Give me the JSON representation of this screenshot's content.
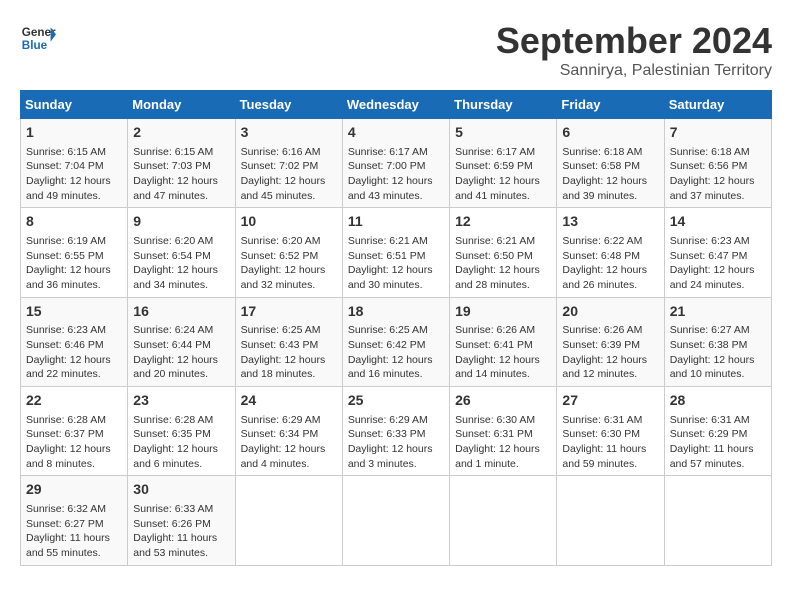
{
  "header": {
    "logo_line1": "General",
    "logo_line2": "Blue",
    "main_title": "September 2024",
    "subtitle": "Sannirya, Palestinian Territory"
  },
  "calendar": {
    "days_of_week": [
      "Sunday",
      "Monday",
      "Tuesday",
      "Wednesday",
      "Thursday",
      "Friday",
      "Saturday"
    ],
    "weeks": [
      [
        {
          "day": "1",
          "sunrise": "Sunrise: 6:15 AM",
          "sunset": "Sunset: 7:04 PM",
          "daylight": "Daylight: 12 hours and 49 minutes."
        },
        {
          "day": "2",
          "sunrise": "Sunrise: 6:15 AM",
          "sunset": "Sunset: 7:03 PM",
          "daylight": "Daylight: 12 hours and 47 minutes."
        },
        {
          "day": "3",
          "sunrise": "Sunrise: 6:16 AM",
          "sunset": "Sunset: 7:02 PM",
          "daylight": "Daylight: 12 hours and 45 minutes."
        },
        {
          "day": "4",
          "sunrise": "Sunrise: 6:17 AM",
          "sunset": "Sunset: 7:00 PM",
          "daylight": "Daylight: 12 hours and 43 minutes."
        },
        {
          "day": "5",
          "sunrise": "Sunrise: 6:17 AM",
          "sunset": "Sunset: 6:59 PM",
          "daylight": "Daylight: 12 hours and 41 minutes."
        },
        {
          "day": "6",
          "sunrise": "Sunrise: 6:18 AM",
          "sunset": "Sunset: 6:58 PM",
          "daylight": "Daylight: 12 hours and 39 minutes."
        },
        {
          "day": "7",
          "sunrise": "Sunrise: 6:18 AM",
          "sunset": "Sunset: 6:56 PM",
          "daylight": "Daylight: 12 hours and 37 minutes."
        }
      ],
      [
        {
          "day": "8",
          "sunrise": "Sunrise: 6:19 AM",
          "sunset": "Sunset: 6:55 PM",
          "daylight": "Daylight: 12 hours and 36 minutes."
        },
        {
          "day": "9",
          "sunrise": "Sunrise: 6:20 AM",
          "sunset": "Sunset: 6:54 PM",
          "daylight": "Daylight: 12 hours and 34 minutes."
        },
        {
          "day": "10",
          "sunrise": "Sunrise: 6:20 AM",
          "sunset": "Sunset: 6:52 PM",
          "daylight": "Daylight: 12 hours and 32 minutes."
        },
        {
          "day": "11",
          "sunrise": "Sunrise: 6:21 AM",
          "sunset": "Sunset: 6:51 PM",
          "daylight": "Daylight: 12 hours and 30 minutes."
        },
        {
          "day": "12",
          "sunrise": "Sunrise: 6:21 AM",
          "sunset": "Sunset: 6:50 PM",
          "daylight": "Daylight: 12 hours and 28 minutes."
        },
        {
          "day": "13",
          "sunrise": "Sunrise: 6:22 AM",
          "sunset": "Sunset: 6:48 PM",
          "daylight": "Daylight: 12 hours and 26 minutes."
        },
        {
          "day": "14",
          "sunrise": "Sunrise: 6:23 AM",
          "sunset": "Sunset: 6:47 PM",
          "daylight": "Daylight: 12 hours and 24 minutes."
        }
      ],
      [
        {
          "day": "15",
          "sunrise": "Sunrise: 6:23 AM",
          "sunset": "Sunset: 6:46 PM",
          "daylight": "Daylight: 12 hours and 22 minutes."
        },
        {
          "day": "16",
          "sunrise": "Sunrise: 6:24 AM",
          "sunset": "Sunset: 6:44 PM",
          "daylight": "Daylight: 12 hours and 20 minutes."
        },
        {
          "day": "17",
          "sunrise": "Sunrise: 6:25 AM",
          "sunset": "Sunset: 6:43 PM",
          "daylight": "Daylight: 12 hours and 18 minutes."
        },
        {
          "day": "18",
          "sunrise": "Sunrise: 6:25 AM",
          "sunset": "Sunset: 6:42 PM",
          "daylight": "Daylight: 12 hours and 16 minutes."
        },
        {
          "day": "19",
          "sunrise": "Sunrise: 6:26 AM",
          "sunset": "Sunset: 6:41 PM",
          "daylight": "Daylight: 12 hours and 14 minutes."
        },
        {
          "day": "20",
          "sunrise": "Sunrise: 6:26 AM",
          "sunset": "Sunset: 6:39 PM",
          "daylight": "Daylight: 12 hours and 12 minutes."
        },
        {
          "day": "21",
          "sunrise": "Sunrise: 6:27 AM",
          "sunset": "Sunset: 6:38 PM",
          "daylight": "Daylight: 12 hours and 10 minutes."
        }
      ],
      [
        {
          "day": "22",
          "sunrise": "Sunrise: 6:28 AM",
          "sunset": "Sunset: 6:37 PM",
          "daylight": "Daylight: 12 hours and 8 minutes."
        },
        {
          "day": "23",
          "sunrise": "Sunrise: 6:28 AM",
          "sunset": "Sunset: 6:35 PM",
          "daylight": "Daylight: 12 hours and 6 minutes."
        },
        {
          "day": "24",
          "sunrise": "Sunrise: 6:29 AM",
          "sunset": "Sunset: 6:34 PM",
          "daylight": "Daylight: 12 hours and 4 minutes."
        },
        {
          "day": "25",
          "sunrise": "Sunrise: 6:29 AM",
          "sunset": "Sunset: 6:33 PM",
          "daylight": "Daylight: 12 hours and 3 minutes."
        },
        {
          "day": "26",
          "sunrise": "Sunrise: 6:30 AM",
          "sunset": "Sunset: 6:31 PM",
          "daylight": "Daylight: 12 hours and 1 minute."
        },
        {
          "day": "27",
          "sunrise": "Sunrise: 6:31 AM",
          "sunset": "Sunset: 6:30 PM",
          "daylight": "Daylight: 11 hours and 59 minutes."
        },
        {
          "day": "28",
          "sunrise": "Sunrise: 6:31 AM",
          "sunset": "Sunset: 6:29 PM",
          "daylight": "Daylight: 11 hours and 57 minutes."
        }
      ],
      [
        {
          "day": "29",
          "sunrise": "Sunrise: 6:32 AM",
          "sunset": "Sunset: 6:27 PM",
          "daylight": "Daylight: 11 hours and 55 minutes."
        },
        {
          "day": "30",
          "sunrise": "Sunrise: 6:33 AM",
          "sunset": "Sunset: 6:26 PM",
          "daylight": "Daylight: 11 hours and 53 minutes."
        },
        null,
        null,
        null,
        null,
        null
      ]
    ]
  }
}
